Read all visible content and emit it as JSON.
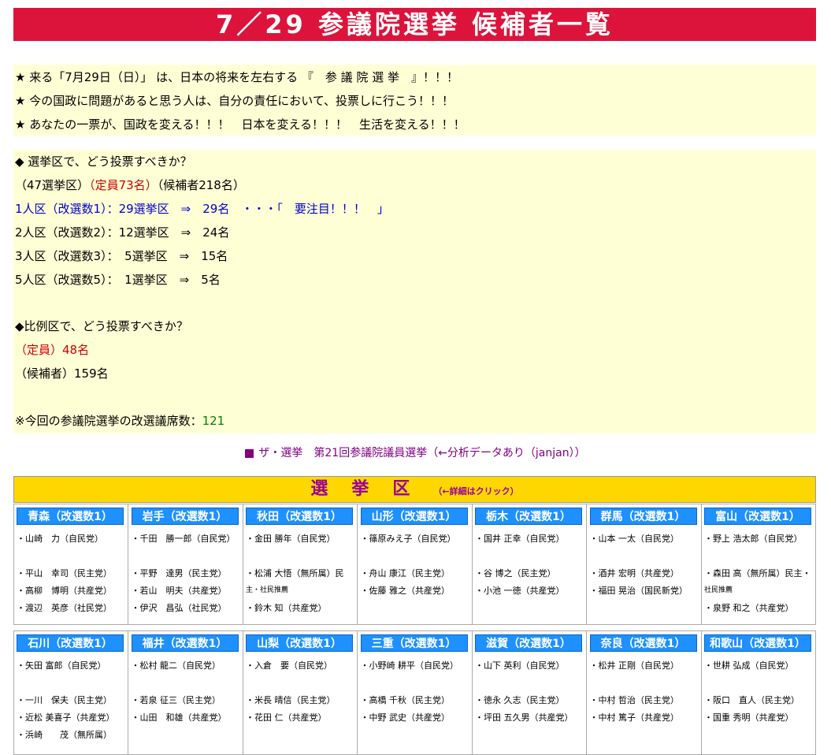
{
  "title": "7／29 参議院選挙 候補者一覧",
  "intro_lines": [
    "★ 来る「7月29日（日）」 は、日本の将来を左右する 『　参 議 院 選 挙　』！！！",
    "★ 今の国政に問題があると思う人は、自分の責任において、投票しに行こう！！！",
    "★ あなたの一票が、国政を変える！！！　日本を変える！！！　生活を変える！！！"
  ],
  "senkyoku": {
    "heading": "◆ 選挙区で、どう投票すべきか？",
    "summary_pre": "（47選挙区）",
    "summary_red": "（定員73名）",
    "summary_post": "（候補者218名）",
    "lines": [
      "1人区（改選数1）：29選挙区　⇒　29名　・・・「　要注目！！！　」",
      "2人区（改選数2）：12選挙区　⇒　24名",
      "3人区（改選数3）：　5選挙区　⇒　15名",
      "5人区（改選数5）：　1選挙区　⇒　5名"
    ]
  },
  "hirei": {
    "heading": "◆比例区で、どう投票すべきか？",
    "teiin": "（定員）48名",
    "kohosha": "（候補者）159名"
  },
  "kaisen": {
    "label": "※今回の参議院選挙の改選議席数：",
    "value": "121"
  },
  "link_text": "ザ・選挙　第21回参議院議員選挙（←分析データあり（janjan））",
  "section": {
    "title": "選挙区",
    "note": "（←詳細はクリック）"
  },
  "districts_row1": [
    {
      "name": "青森（改選数1）",
      "candidates": [
        "・山崎　力（自民党）",
        "",
        "・平山　幸司（民主党）",
        "・高柳　博明（共産党）",
        "・渡辺　英彦（社民党）"
      ]
    },
    {
      "name": "岩手（改選数1）",
      "candidates": [
        "・千田　勝一郎（自民党）",
        "",
        "・平野　達男（民主党）",
        "・若山　明夫（共産党）",
        "・伊沢　昌弘（社民党）"
      ]
    },
    {
      "name": "秋田（改選数1）",
      "candidates": [
        "・金田 勝年（自民党）",
        "",
        "・松浦 大悟（無所属）民",
        "主・社民推薦",
        "・鈴木 知（共産党）"
      ]
    },
    {
      "name": "山形（改選数1）",
      "candidates": [
        "・篠原みえ子（自民党）",
        "",
        "・舟山 康江（民主党）",
        "・佐藤 雅之（共産党）",
        ""
      ]
    },
    {
      "name": "栃木（改選数1）",
      "candidates": [
        "・国井 正幸（自民党）",
        "",
        "・谷 博之（民主党）",
        "・小池 一徳（共産党）",
        ""
      ]
    },
    {
      "name": "群馬（改選数1）",
      "candidates": [
        "・山本 一太（自民党）",
        "",
        "・酒井 宏明（共産党）",
        "・福田 晃治（国民新党）",
        ""
      ]
    },
    {
      "name": "富山（改選数1）",
      "candidates": [
        "・野上 浩太郎（自民党）",
        "",
        "・森田 高（無所属）民主・",
        "社民推薦",
        "・泉野 和之（共産党）"
      ]
    }
  ],
  "districts_row2": [
    {
      "name": "石川（改選数1）",
      "candidates": [
        "・矢田 富郎（自民党）",
        "",
        "・一川　保夫（民主党）",
        "・近松 美喜子（共産党）",
        "・浜崎　　茂（無所属）"
      ]
    },
    {
      "name": "福井（改選数1）",
      "candidates": [
        "・松村 龍二（自民党）",
        "",
        "・若泉 征三（民主党）",
        "・山田　和雄（共産党）",
        ""
      ]
    },
    {
      "name": "山梨（改選数1）",
      "candidates": [
        "・入倉　要（自民党）",
        "",
        "・米長 晴信（民主党）",
        "・花田 仁（共産党）",
        ""
      ]
    },
    {
      "name": "三重（改選数1）",
      "candidates": [
        "・小野崎 耕平（自民党）",
        "",
        "・高橋 千秋（民主党）",
        "・中野 武史（共産党）",
        ""
      ]
    },
    {
      "name": "滋賀（改選数1）",
      "candidates": [
        "・山下 英利（自民党）",
        "",
        "・徳永 久志（民主党）",
        "・坪田 五久男（共産党）",
        ""
      ]
    },
    {
      "name": "奈良（改選数1）",
      "candidates": [
        "・松井 正剛（自民党）",
        "",
        "・中村 哲治（民主党）",
        "・中村 篤子（共産党）",
        ""
      ]
    },
    {
      "name": "和歌山（改選数1）",
      "candidates": [
        "・世耕 弘成（自民党）",
        "",
        "・阪口　直人（民主党）",
        "・国重 秀明（共産党）",
        ""
      ]
    }
  ],
  "colors": {
    "title_bg": "#dc143c",
    "box_bg": "#ffffd6",
    "header_bg": "#ffd700",
    "district_head_bg": "#1e90ff"
  }
}
